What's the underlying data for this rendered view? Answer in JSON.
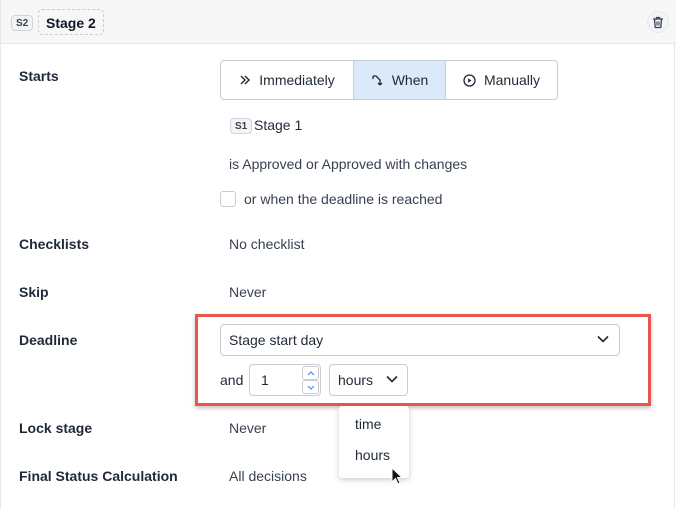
{
  "header": {
    "stage_badge": "S2",
    "stage_title": "Stage 2",
    "delete_icon": "trash-icon"
  },
  "starts": {
    "label": "Starts",
    "options": [
      {
        "label": "Immediately",
        "icon": "double-chevron-right-icon",
        "selected": false
      },
      {
        "label": "When",
        "icon": "branch-merge-icon",
        "selected": true
      },
      {
        "label": "Manually",
        "icon": "play-circle-icon",
        "selected": false
      }
    ],
    "source_badge": "S1",
    "source_stage": "Stage 1",
    "condition": "is Approved or Approved with changes",
    "deadline_checkbox_label": "or when the deadline is reached",
    "deadline_checkbox_checked": false
  },
  "checklists": {
    "label": "Checklists",
    "value": "No checklist"
  },
  "skip": {
    "label": "Skip",
    "value": "Never"
  },
  "deadline": {
    "label": "Deadline",
    "base_value": "Stage start day",
    "and_label": "and",
    "amount": "1",
    "unit": "hours",
    "unit_options": [
      "time",
      "hours"
    ]
  },
  "lock_stage": {
    "label": "Lock stage",
    "value": "Never"
  },
  "final_status": {
    "label": "Final Status Calculation",
    "value": "All decisions"
  },
  "colors": {
    "accent": "#dbe9fb",
    "highlight_border": "#e8574b",
    "header_bg": "#f7f7f8"
  }
}
